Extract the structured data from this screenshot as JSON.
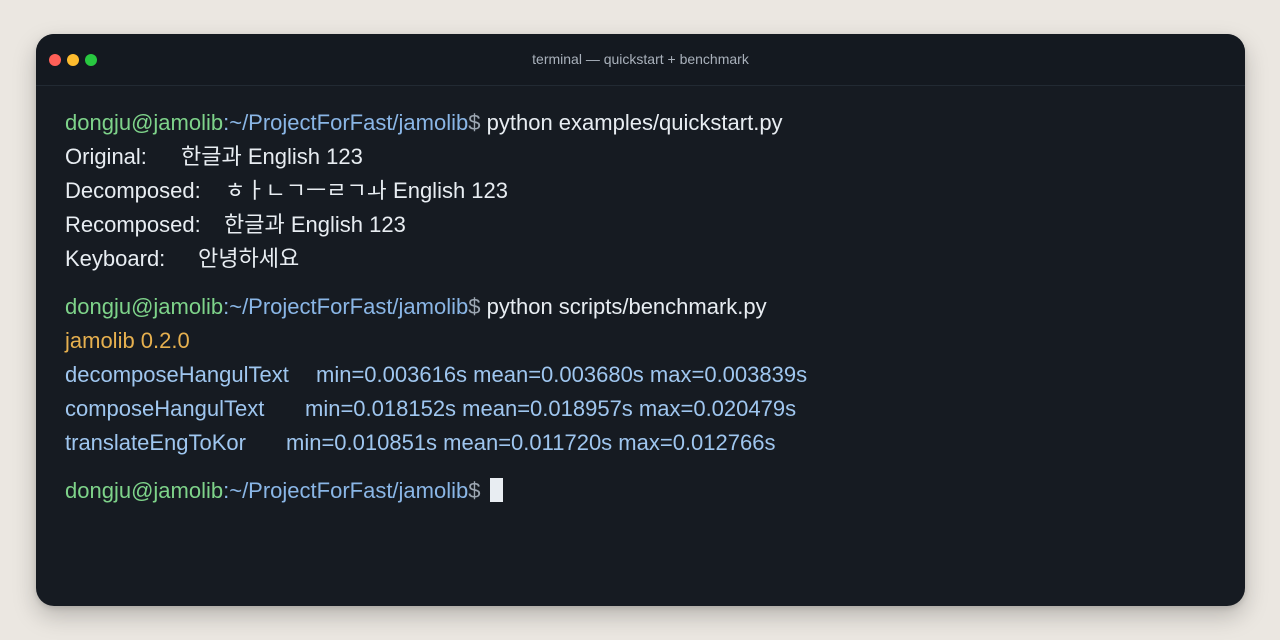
{
  "window": {
    "title": "terminal — quickstart + benchmark"
  },
  "prompt": {
    "user_host": "dongju@jamolib",
    "colon": ":",
    "path": "~/ProjectForFast/jamolib",
    "symbol": "$"
  },
  "commands": [
    {
      "text": "python examples/quickstart.py"
    },
    {
      "text": "python scripts/benchmark.py"
    }
  ],
  "quickstart_output": [
    {
      "label": "Original:",
      "value": "한글과 English 123"
    },
    {
      "label": "Decomposed:",
      "value": "ㅎㅏㄴㄱㅡㄹㄱㅘ English 123"
    },
    {
      "label": "Recomposed:",
      "value": "한글과 English 123"
    },
    {
      "label": "Keyboard:",
      "value": "안녕하세요"
    }
  ],
  "benchmark_output": {
    "version_line": "jamolib 0.2.0",
    "rows": [
      {
        "name": "decomposeHangulText",
        "stats": "min=0.003616s mean=0.003680s max=0.003839s"
      },
      {
        "name": "composeHangulText",
        "stats": "min=0.018152s mean=0.018957s max=0.020479s"
      },
      {
        "name": "translateEngToKor",
        "stats": "min=0.010851s mean=0.011720s max=0.012766s"
      }
    ]
  },
  "colors": {
    "terminal_background": "#161b22",
    "prompt_user": "#7ed38a",
    "prompt_path": "#8ab6e6",
    "version_text": "#e6b04f",
    "benchmark_text": "#9fc6ef"
  }
}
